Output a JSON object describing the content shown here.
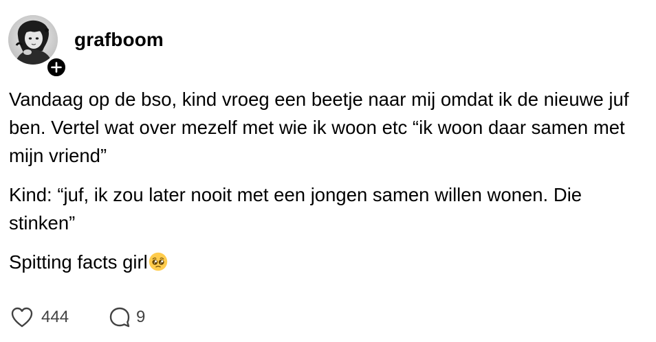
{
  "post": {
    "author": {
      "username": "grafboom",
      "avatar_icon": "profile-photo",
      "follow_icon": "plus-icon"
    },
    "paragraphs": [
      "Vandaag op de bso, kind vroeg een beetje naar mij omdat ik de nieuwe juf ben. Vertel wat over mezelf met wie ik woon etc “ik woon daar samen met mijn vriend”",
      "Kind: “juf, ik zou later nooit met een jongen samen willen wonen. Die stinken”",
      "Spitting facts girl"
    ],
    "final_emoji": "pleading-face-emoji",
    "actions": {
      "likes": "444",
      "replies": "9"
    }
  },
  "colors": {
    "text": "#000000",
    "muted": "#424242",
    "background": "#ffffff"
  }
}
